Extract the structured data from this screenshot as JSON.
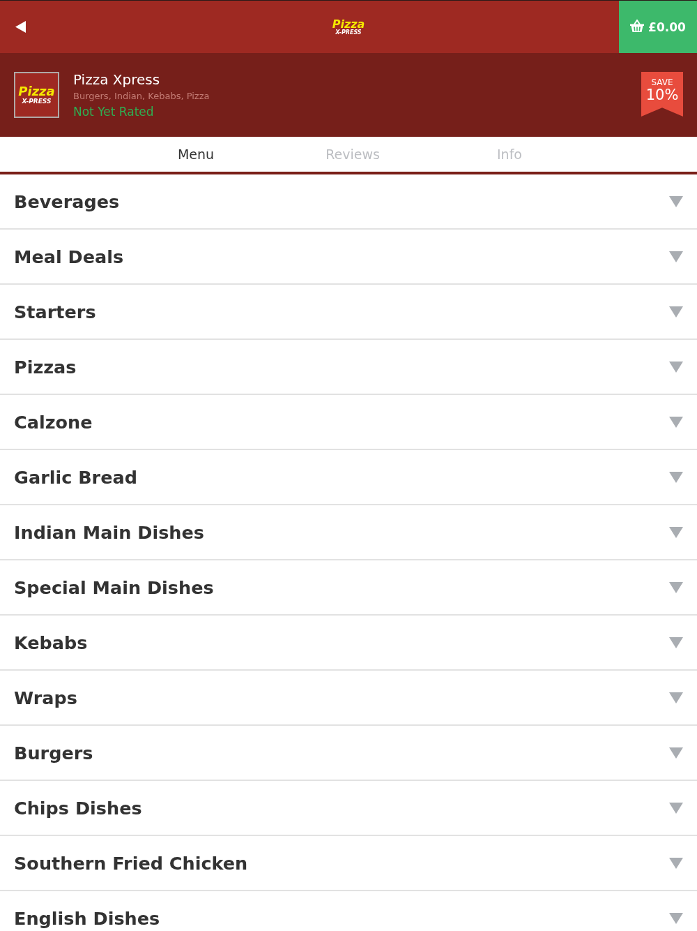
{
  "header": {
    "logo": {
      "line_1": "Pizza",
      "line_2": "X-PRESS"
    },
    "cart_total": "£0.00"
  },
  "restaurant": {
    "logo": {
      "line_1": "Pizza",
      "line_2": "X-PRESS"
    },
    "name": "Pizza Xpress",
    "cuisines": "Burgers, Indian, Kebabs, Pizza",
    "rating": "Not Yet Rated",
    "badge": {
      "label": "SAVE",
      "value": "10%"
    }
  },
  "tabs": [
    {
      "label": "Menu",
      "selected": true
    },
    {
      "label": "Reviews",
      "selected": false
    },
    {
      "label": "Info",
      "selected": false
    }
  ],
  "categories": [
    {
      "name": "Beverages",
      "expanded": false
    },
    {
      "name": "Meal Deals",
      "expanded": false
    },
    {
      "name": "Starters",
      "expanded": false
    },
    {
      "name": "Pizzas",
      "expanded": false
    },
    {
      "name": "Calzone",
      "expanded": false
    },
    {
      "name": "Garlic Bread",
      "expanded": false
    },
    {
      "name": "Indian Main Dishes",
      "expanded": false
    },
    {
      "name": "Special Main Dishes",
      "expanded": false
    },
    {
      "name": "Kebabs",
      "expanded": false
    },
    {
      "name": "Wraps",
      "expanded": false
    },
    {
      "name": "Burgers",
      "expanded": false
    },
    {
      "name": "Chips Dishes",
      "expanded": false
    },
    {
      "name": "Southern Fried Chicken",
      "expanded": false
    },
    {
      "name": "English Dishes",
      "expanded": false
    }
  ]
}
